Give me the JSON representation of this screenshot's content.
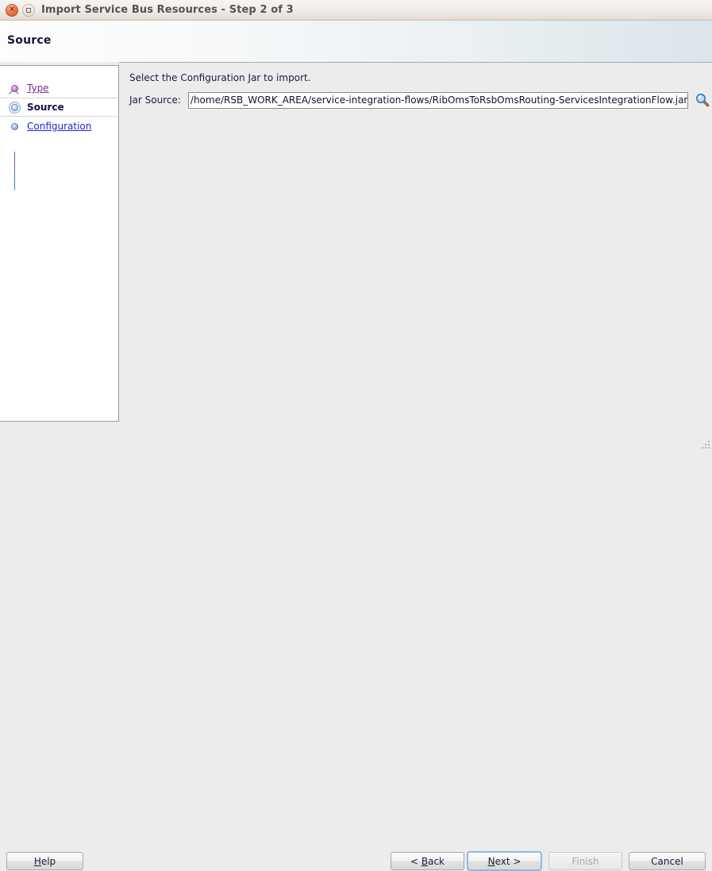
{
  "window": {
    "title": "Import Service Bus Resources - Step 2 of 3",
    "close_icon": "close-icon",
    "maximize_icon": "maximize-icon"
  },
  "banner": {
    "title": "Source"
  },
  "sidebar": {
    "items": [
      {
        "label": "Type",
        "state": "visited",
        "node_icon": "tree-node-purple-icon"
      },
      {
        "label": "Source",
        "state": "current",
        "node_icon": "tree-node-current-icon"
      },
      {
        "label": "Configuration",
        "state": "link",
        "node_icon": "tree-node-blue-icon"
      }
    ]
  },
  "main": {
    "instruction": "Select the Configuration Jar to import.",
    "jar_source": {
      "label": "Jar Source:",
      "value": "/home/RSB_WORK_AREA/service-integration-flows/RibOmsToRsbOmsRouting-ServicesIntegrationFlow.jar",
      "placeholder": "",
      "browse_icon": "magnifier-browse-icon"
    }
  },
  "footer": {
    "help": "Help",
    "back": "< Back",
    "back_mnemonic": "B",
    "next": "Next >",
    "next_mnemonic": "N",
    "finish": "Finish",
    "finish_enabled": false,
    "cancel": "Cancel"
  },
  "colors": {
    "titlebar": "#efeae5",
    "content_bg": "#ececec",
    "sidebar_bg": "#ffffff",
    "link": "#2424cc",
    "visited_link": "#7d2a8e",
    "current_text": "#11114a",
    "focus_ring": "#8fb8e0",
    "close_button": "#e8703f"
  }
}
